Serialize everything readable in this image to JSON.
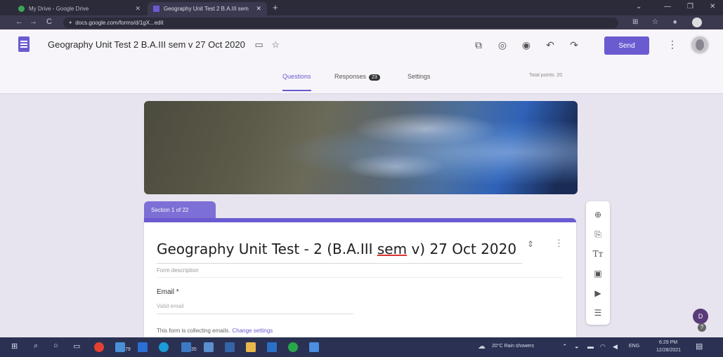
{
  "browser": {
    "tabs": [
      {
        "title": "My Drive - Google Drive"
      },
      {
        "title": "Geography Unit Test 2 B.A.III sem"
      }
    ],
    "url": "docs.google.com/forms/d/1gX...edit"
  },
  "header": {
    "form_title": "Geography Unit Test 2 B.A.III sem v 27 Oct 2020",
    "send_label": "Send"
  },
  "form_tabs": {
    "questions": "Questions",
    "responses": "Responses",
    "responses_count": "23",
    "settings": "Settings",
    "total_points": "Total points: 20"
  },
  "section": {
    "label": "Section 1 of 22",
    "title_prefix": "Geography Unit Test - 2 (B.A.III ",
    "title_underlined": "sem",
    "title_suffix": " v) 27 Oct 2020",
    "description_placeholder": "Form description",
    "email_label": "Email *",
    "email_placeholder": "Valid email",
    "collecting_note": "This form is collecting emails.",
    "change_settings": "Change settings"
  },
  "help": {
    "avatar_letter": "D",
    "question_mark": "?"
  },
  "taskbar": {
    "weather": "20°C Rain showers",
    "language": "ENG",
    "time": "6:29 PM",
    "date": "12/28/2021",
    "badge_a": "79",
    "badge_b": "35"
  }
}
